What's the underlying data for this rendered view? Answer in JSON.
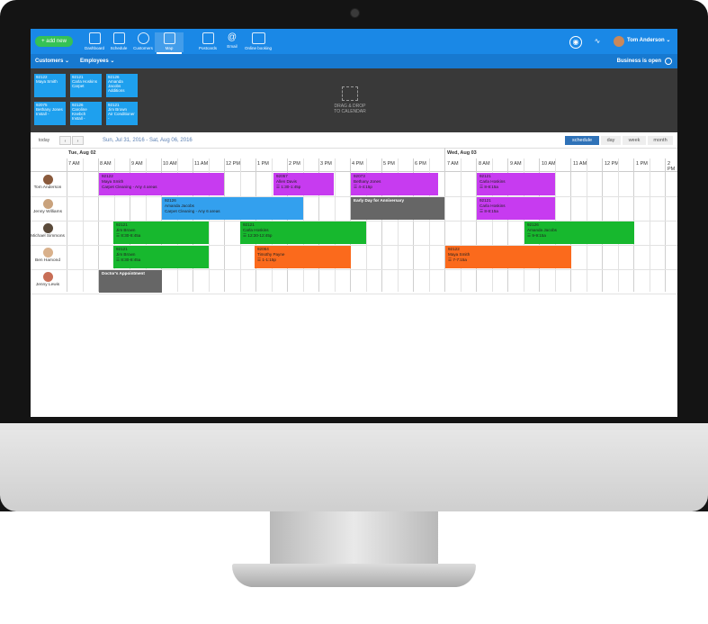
{
  "topbar": {
    "add_new": "+ add new",
    "nav": [
      "Dashboard",
      "Schedule",
      "Customers",
      "Map",
      "Postcards",
      "Email",
      "Online booking"
    ],
    "user": "Tom Anderson",
    "user_chevron": "⌄"
  },
  "subbar": {
    "customers": "Customers ⌄",
    "employees": "Employees ⌄",
    "status": "Business is open"
  },
  "tray": {
    "cards": [
      {
        "id": "92122",
        "l2": "Maya Smith",
        "l3": ""
      },
      {
        "id": "92121",
        "l2": "Carla Hoskins",
        "l3": "Carpet"
      },
      {
        "id": "92126",
        "l2": "Amanda Jacobs",
        "l3": "Additions"
      },
      {
        "id": "92075",
        "l2": "Bethany Jones",
        "l3": "Install -"
      },
      {
        "id": "92126",
        "l2": "Caroline Knebch",
        "l3": "Install -"
      },
      {
        "id": "92121",
        "l2": "Jim Brown",
        "l3": "Air Conditioner -"
      }
    ],
    "drop_text_1": "DRAG & DROP",
    "drop_text_2": "TO CALENDAR"
  },
  "toolbar": {
    "today": "today",
    "prev": "‹",
    "next": "›",
    "range": "Sun, Jul 31, 2016 - Sat, Aug 06, 2016",
    "views": [
      "schedule",
      "day",
      "week",
      "month"
    ]
  },
  "calendar": {
    "days": [
      "Tue, Aug 02",
      "Wed, Aug 03"
    ],
    "hours_day1": [
      "7 AM",
      "8 AM",
      "9 AM",
      "10 AM",
      "11 AM",
      "12 PM",
      "1 PM",
      "2 PM",
      "3 PM",
      "4 PM",
      "5 PM",
      "6 PM"
    ],
    "hours_day2": [
      "7 AM",
      "8 AM",
      "9 AM",
      "10 AM",
      "11 AM",
      "12 PM",
      "1 PM",
      "2 PM"
    ],
    "resources": [
      "Tom Anderson",
      "Jenny Williams",
      "Michael Simmons",
      "Ben Hamond",
      "Jenny Lewis"
    ],
    "events": [
      {
        "l1": "92122",
        "l2": "Maya Smith",
        "l3": "Carpet Cleaning - Any 4 areas"
      },
      {
        "l1": "92057",
        "l2": "Allen Davis",
        "l3": "☰ 1:30-1:45p"
      },
      {
        "l1": "92073",
        "l2": "Bethany Jones",
        "l3": "☰ 4-4:15p"
      },
      {
        "l1": "92121",
        "l2": "Carla Hoskins",
        "l3": "☰ 8-8:15a"
      },
      {
        "l1": "92126",
        "l2": "Amanda Jacobs",
        "l3": "Carpet Cleaning - Any 6 areas"
      },
      {
        "l1": "Early Day for Anniversary",
        "l2": "",
        "l3": ""
      },
      {
        "l1": "92121",
        "l2": "Carla Hoskins",
        "l3": "☰ 8-8:15a"
      },
      {
        "l1": "92121",
        "l2": "Jim Brown",
        "l3": "☰ 8:30-8:45a"
      },
      {
        "l1": "92121",
        "l2": "Carla Hoskins",
        "l3": "☰ 12:30-12:45p"
      },
      {
        "l1": "92126",
        "l2": "Amanda Jacobs",
        "l3": "☰ 9-9:15a"
      },
      {
        "l1": "92121",
        "l2": "Jim Brown",
        "l3": "☰ 8:30-8:45a"
      },
      {
        "l1": "92064",
        "l2": "Timothy Payne",
        "l3": "☰ 1-1:15p"
      },
      {
        "l1": "92122",
        "l2": "Maya Smith",
        "l3": "☰ 7-7:15a"
      },
      {
        "l1": "Doctor's Appointment",
        "l2": "",
        "l3": ""
      }
    ]
  },
  "colors": {
    "topbar": "#1a88e6",
    "subbar": "#1779d0",
    "tray": "#393939",
    "card": "#1ea0ee",
    "purple": "#c73bf0",
    "blue": "#33a0ee",
    "gray": "#666666",
    "green": "#17b82e",
    "orange": "#fb6a1c",
    "add_new": "#35c255"
  }
}
